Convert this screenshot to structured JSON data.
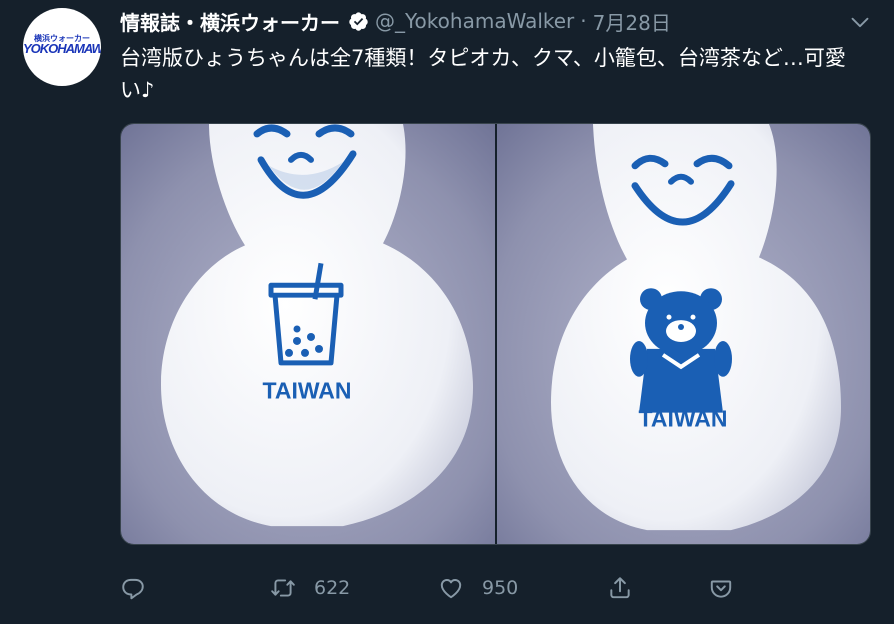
{
  "account": {
    "display_name": "情報誌・横浜ウォーカー",
    "handle": "@_YokohamaWalker",
    "date": "7月28日",
    "avatar_small_text": "横浜ウォーカー",
    "avatar_logo_text": "YOKOHAMAWalker"
  },
  "tweet": {
    "separator": "·",
    "text": "台湾版ひょうちゃんは全7種類！タピオカ、クマ、小籠包、台湾茶など…可愛い♪"
  },
  "media": {
    "left_label": "TAIWAN",
    "right_label": "TAIWAN"
  },
  "actions": {
    "reply_icon": "reply-icon",
    "retweet_icon": "retweet-icon",
    "retweet_count": "622",
    "like_icon": "heart-icon",
    "like_count": "950",
    "share_icon": "share-icon",
    "save_icon": "pocket-icon"
  },
  "colors": {
    "background": "#15202b",
    "secondary_text": "#8899a6",
    "brand_blue": "#1a5fb4"
  }
}
